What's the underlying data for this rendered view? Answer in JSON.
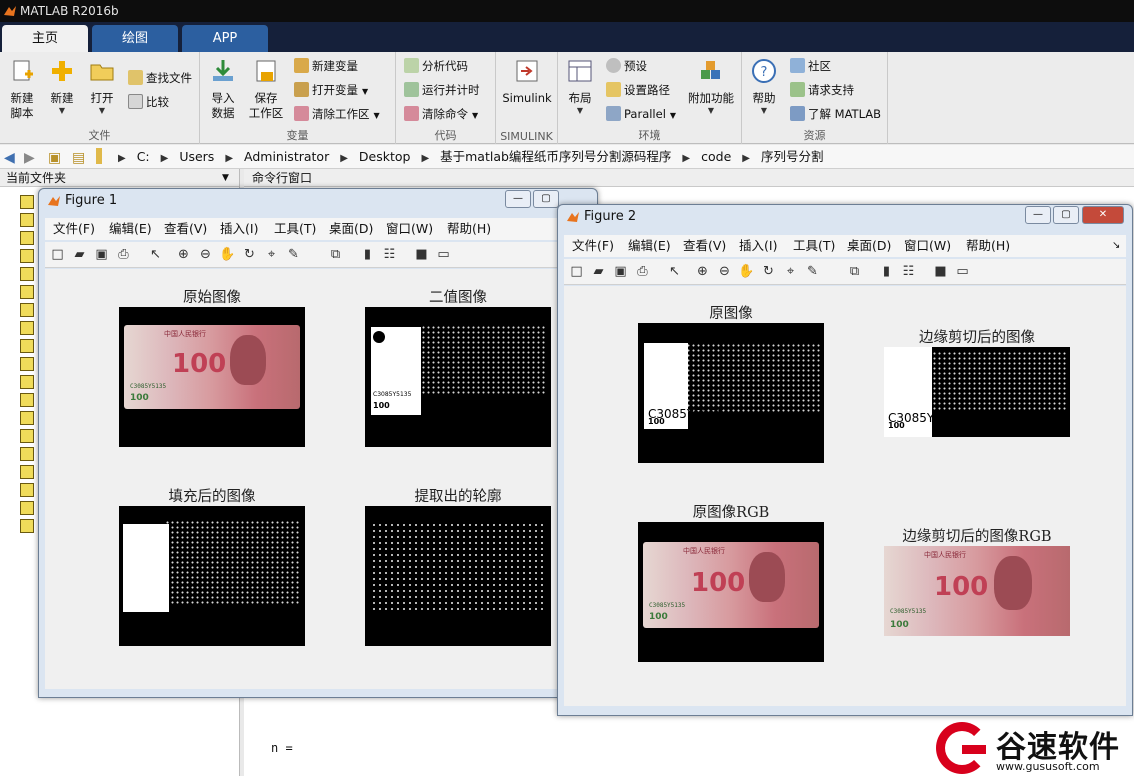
{
  "app": {
    "title": "MATLAB R2016b"
  },
  "tabs": [
    "主页",
    "绘图",
    "APP"
  ],
  "ribbon": {
    "file": {
      "label": "文件",
      "new_script": "新建\n脚本",
      "new": "新建",
      "open": "打开",
      "find_files": "查找文件",
      "compare": "比较"
    },
    "variable": {
      "label": "变量",
      "import": "导入\n数据",
      "save": "保存\n工作区",
      "new_var": "新建变量",
      "open_var": "打开变量",
      "clear_ws": "清除工作区"
    },
    "code": {
      "label": "代码",
      "analyze": "分析代码",
      "run_time": "运行并计时",
      "clear_cmd": "清除命令"
    },
    "simulink": {
      "label": "SIMULINK",
      "simulink": "Simulink"
    },
    "env": {
      "label": "环境",
      "layout": "布局",
      "prefs": "预设",
      "set_path": "设置路径",
      "parallel": "Parallel",
      "addons": "附加功能"
    },
    "resources": {
      "label": "资源",
      "help": "帮助",
      "community": "社区",
      "support": "请求支持",
      "learn": "了解 MATLAB"
    }
  },
  "address": {
    "crumbs": [
      "C:",
      "Users",
      "Administrator",
      "Desktop",
      "基于matlab编程纸币序列号分割源码程序",
      "code",
      "序列号分割"
    ]
  },
  "panels": {
    "current_folder": "当前文件夹",
    "command_window": "命令行窗口",
    "cmd_text": "n ="
  },
  "figure1": {
    "title": "Figure 1",
    "menu": [
      "文件(F)",
      "编辑(E)",
      "查看(V)",
      "插入(I)",
      "工具(T)",
      "桌面(D)",
      "窗口(W)",
      "帮助(H)"
    ],
    "axes": [
      "原始图像",
      "二值图像",
      "填充后的图像",
      "提取出的轮廓"
    ]
  },
  "figure2": {
    "title": "Figure 2",
    "menu": [
      "文件(F)",
      "编辑(E)",
      "查看(V)",
      "插入(I)",
      "工具(T)",
      "桌面(D)",
      "窗口(W)",
      "帮助(H)"
    ],
    "axes": [
      "原图像",
      "边缘剪切后的图像",
      "原图像RGB",
      "边缘剪切后的图像RGB"
    ]
  },
  "bill": {
    "denom": "100",
    "serial": "C3085Y5135",
    "bank": "中国人民银行"
  },
  "watermark": {
    "name": "谷速软件",
    "url": "www.gususoft.com"
  }
}
